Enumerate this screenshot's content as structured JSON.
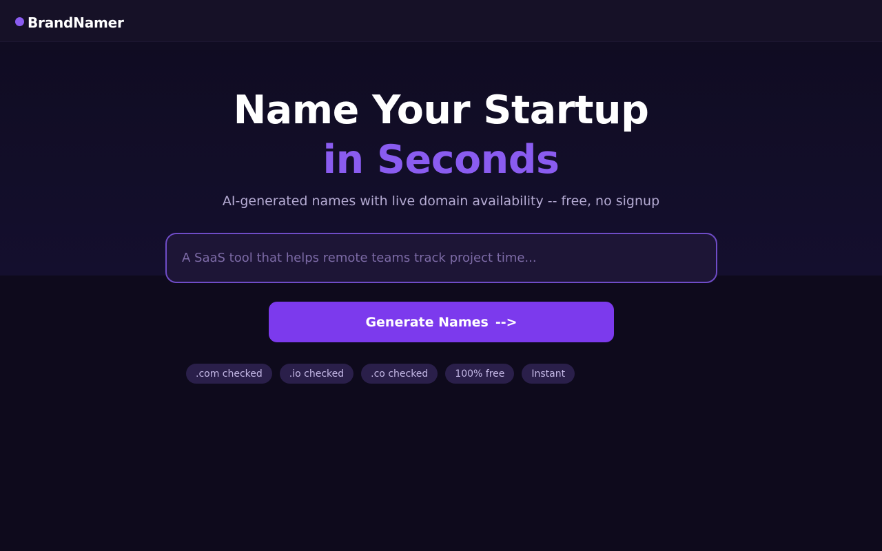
{
  "brand": {
    "name": "BrandNamer",
    "icon": "hexagon-logo-icon",
    "accent_color": "#8a5cf0"
  },
  "hero": {
    "title_line1": "Name Your Startup",
    "title_line2": "in Seconds",
    "subtitle": "AI-generated names with live domain availability  --  free, no signup"
  },
  "search": {
    "placeholder": "A SaaS tool that helps remote teams track project time...",
    "value": ""
  },
  "cta": {
    "label": "Generate Names",
    "arrow": "-->",
    "color": "#7c3aed"
  },
  "tags": [
    ".com checked",
    ".io checked",
    ".co checked",
    "100% free",
    "Instant"
  ]
}
